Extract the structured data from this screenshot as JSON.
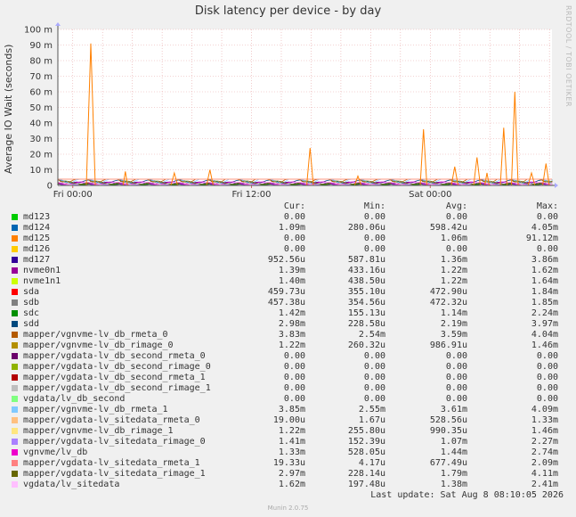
{
  "title": "Disk latency per device - by day",
  "side_credit": "RRDTOOL / TOBI OETIKER",
  "ylabel": "Average IO Wait (seconds)",
  "header": {
    "cur": "Cur:",
    "min": "Min:",
    "avg": "Avg:",
    "max": "Max:"
  },
  "last_update": "Last update: Sat Aug  8 08:10:05 2026",
  "footer": "Munin 2.0.75",
  "chart_data": {
    "type": "line",
    "title": "Disk latency per device - by day",
    "ylabel": "Average IO Wait (seconds)",
    "yticks": [
      "0",
      "10 m",
      "20 m",
      "30 m",
      "40 m",
      "50 m",
      "60 m",
      "70 m",
      "80 m",
      "90 m",
      "100 m"
    ],
    "ylim": [
      0,
      100
    ],
    "y_unit": "m",
    "xticks": [
      "Fri 00:00",
      "Fri 12:00",
      "Sat 00:00"
    ],
    "x_hours_ticks": [
      0,
      12,
      24
    ],
    "x_hours_range": [
      -1,
      32.17
    ],
    "grid": true,
    "spike_series": {
      "name": "md125",
      "points": [
        [
          4.6,
          0
        ],
        [
          5,
          91
        ],
        [
          5.4,
          0
        ],
        [
          7.9,
          0
        ],
        [
          8.1,
          9
        ],
        [
          8.3,
          0
        ],
        [
          12.2,
          0
        ],
        [
          12.5,
          8
        ],
        [
          12.8,
          0
        ],
        [
          15.4,
          0
        ],
        [
          15.7,
          10
        ],
        [
          16.0,
          0
        ],
        [
          24.4,
          0
        ],
        [
          24.7,
          24
        ],
        [
          25.0,
          0
        ],
        [
          28.7,
          0
        ],
        [
          29.0,
          6
        ],
        [
          29.3,
          0
        ],
        [
          34.6,
          0
        ],
        [
          34.9,
          36
        ],
        [
          35.2,
          0
        ],
        [
          37.4,
          0
        ],
        [
          37.7,
          12
        ],
        [
          38.0,
          0
        ],
        [
          39.4,
          0
        ],
        [
          39.7,
          18
        ],
        [
          40.0,
          0
        ],
        [
          40.4,
          0
        ],
        [
          40.6,
          8
        ],
        [
          40.8,
          0
        ],
        [
          41.8,
          0
        ],
        [
          42.1,
          37
        ],
        [
          42.4,
          0
        ],
        [
          42.8,
          0
        ],
        [
          43.1,
          60
        ],
        [
          43.4,
          0
        ],
        [
          44.3,
          0
        ],
        [
          44.6,
          8
        ],
        [
          44.9,
          0
        ],
        [
          45.6,
          0
        ],
        [
          45.9,
          14
        ],
        [
          46.2,
          0
        ]
      ]
    },
    "series_legend": [
      {
        "name": "md123",
        "color": "#00cc00",
        "cur": "0.00",
        "min": "0.00",
        "avg": "0.00",
        "max": "0.00"
      },
      {
        "name": "md124",
        "color": "#0066b3",
        "cur": "1.09m",
        "min": "280.06u",
        "avg": "598.42u",
        "max": "4.05m"
      },
      {
        "name": "md125",
        "color": "#ff8000",
        "cur": "0.00",
        "min": "0.00",
        "avg": "1.06m",
        "max": "91.12m"
      },
      {
        "name": "md126",
        "color": "#ffcc00",
        "cur": "0.00",
        "min": "0.00",
        "avg": "0.00",
        "max": "0.00"
      },
      {
        "name": "md127",
        "color": "#330099",
        "cur": "952.56u",
        "min": "587.81u",
        "avg": "1.36m",
        "max": "3.86m"
      },
      {
        "name": "nvme0n1",
        "color": "#990099",
        "cur": "1.39m",
        "min": "433.16u",
        "avg": "1.22m",
        "max": "1.62m"
      },
      {
        "name": "nvme1n1",
        "color": "#ccff00",
        "cur": "1.40m",
        "min": "438.50u",
        "avg": "1.22m",
        "max": "1.64m"
      },
      {
        "name": "sda",
        "color": "#ff0000",
        "cur": "459.73u",
        "min": "355.10u",
        "avg": "472.90u",
        "max": "1.84m"
      },
      {
        "name": "sdb",
        "color": "#808080",
        "cur": "457.38u",
        "min": "354.56u",
        "avg": "472.32u",
        "max": "1.85m"
      },
      {
        "name": "sdc",
        "color": "#008f00",
        "cur": "1.42m",
        "min": "155.13u",
        "avg": "1.14m",
        "max": "2.24m"
      },
      {
        "name": "sdd",
        "color": "#00487d",
        "cur": "2.98m",
        "min": "228.58u",
        "avg": "2.19m",
        "max": "3.97m"
      },
      {
        "name": "mapper/vgnvme-lv_db_rmeta_0",
        "color": "#b35a00",
        "cur": "3.83m",
        "min": "2.54m",
        "avg": "3.59m",
        "max": "4.04m"
      },
      {
        "name": "mapper/vgnvme-lv_db_rimage_0",
        "color": "#b38f00",
        "cur": "1.22m",
        "min": "260.32u",
        "avg": "986.91u",
        "max": "1.46m"
      },
      {
        "name": "mapper/vgdata-lv_db_second_rmeta_0",
        "color": "#6b006b",
        "cur": "0.00",
        "min": "0.00",
        "avg": "0.00",
        "max": "0.00"
      },
      {
        "name": "mapper/vgdata-lv_db_second_rimage_0",
        "color": "#8fb300",
        "cur": "0.00",
        "min": "0.00",
        "avg": "0.00",
        "max": "0.00"
      },
      {
        "name": "mapper/vgdata-lv_db_second_rmeta_1",
        "color": "#b30000",
        "cur": "0.00",
        "min": "0.00",
        "avg": "0.00",
        "max": "0.00"
      },
      {
        "name": "mapper/vgdata-lv_db_second_rimage_1",
        "color": "#bebebe",
        "cur": "0.00",
        "min": "0.00",
        "avg": "0.00",
        "max": "0.00"
      },
      {
        "name": "vgdata/lv_db_second",
        "color": "#80ff80",
        "cur": "0.00",
        "min": "0.00",
        "avg": "0.00",
        "max": "0.00"
      },
      {
        "name": "mapper/vgnvme-lv_db_rmeta_1",
        "color": "#80c9ff",
        "cur": "3.85m",
        "min": "2.55m",
        "avg": "3.61m",
        "max": "4.09m"
      },
      {
        "name": "mapper/vgdata-lv_sitedata_rmeta_0",
        "color": "#ffc080",
        "cur": "19.00u",
        "min": "1.67u",
        "avg": "528.56u",
        "max": "1.33m"
      },
      {
        "name": "mapper/vgnvme-lv_db_rimage_1",
        "color": "#ffe680",
        "cur": "1.22m",
        "min": "255.80u",
        "avg": "990.35u",
        "max": "1.46m"
      },
      {
        "name": "mapper/vgdata-lv_sitedata_rimage_0",
        "color": "#aa80ff",
        "cur": "1.41m",
        "min": "152.39u",
        "avg": "1.07m",
        "max": "2.27m"
      },
      {
        "name": "vgnvme/lv_db",
        "color": "#ee00cc",
        "cur": "1.33m",
        "min": "528.05u",
        "avg": "1.44m",
        "max": "2.74m"
      },
      {
        "name": "mapper/vgdata-lv_sitedata_rmeta_1",
        "color": "#ff8080",
        "cur": "19.33u",
        "min": "4.17u",
        "avg": "677.49u",
        "max": "2.09m"
      },
      {
        "name": "mapper/vgdata-lv_sitedata_rimage_1",
        "color": "#666600",
        "cur": "2.97m",
        "min": "228.14u",
        "avg": "1.79m",
        "max": "4.11m"
      },
      {
        "name": "vgdata/lv_sitedata",
        "color": "#ffbfff",
        "cur": "1.62m",
        "min": "197.48u",
        "avg": "1.38m",
        "max": "2.41m"
      }
    ]
  }
}
